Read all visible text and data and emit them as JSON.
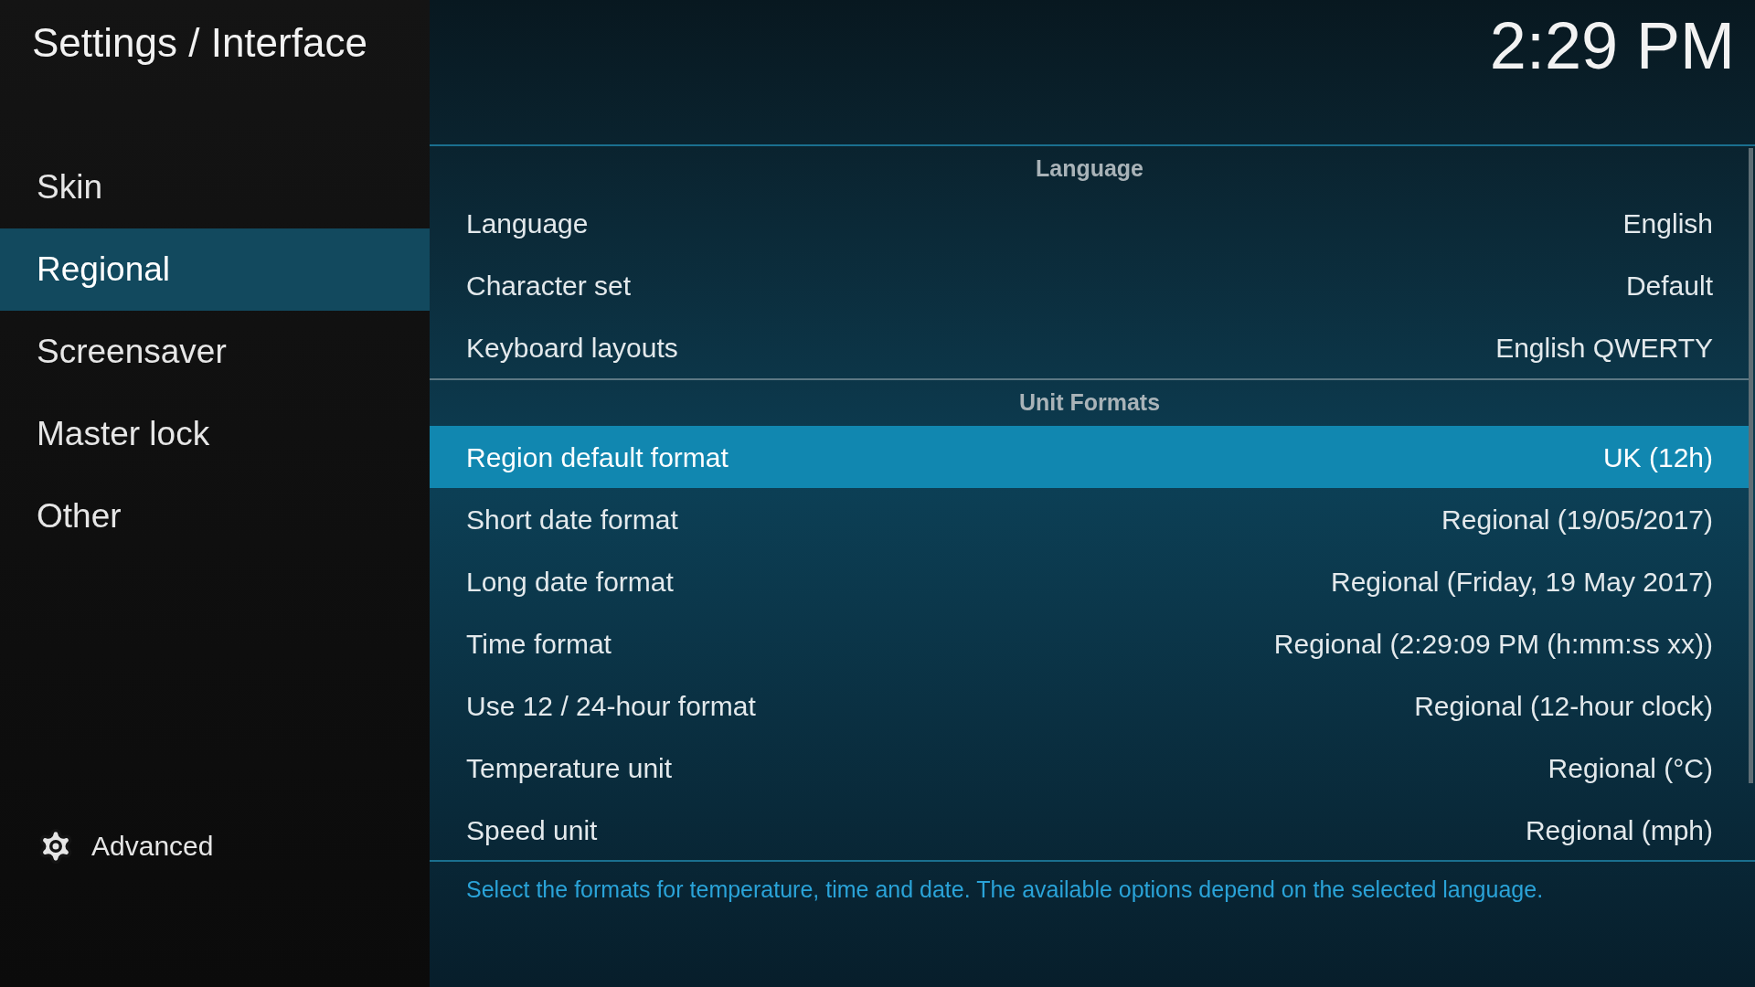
{
  "header": {
    "title": "Settings / Interface",
    "clock": "2:29 PM"
  },
  "sidebar": {
    "items": [
      {
        "label": "Skin",
        "selected": false
      },
      {
        "label": "Regional",
        "selected": true
      },
      {
        "label": "Screensaver",
        "selected": false
      },
      {
        "label": "Master lock",
        "selected": false
      },
      {
        "label": "Other",
        "selected": false
      }
    ],
    "level_button": {
      "label": "Advanced"
    }
  },
  "sections": [
    {
      "title": "Language",
      "rows": [
        {
          "label": "Language",
          "value": "English",
          "selected": false
        },
        {
          "label": "Character set",
          "value": "Default",
          "selected": false
        },
        {
          "label": "Keyboard layouts",
          "value": "English QWERTY",
          "selected": false
        }
      ]
    },
    {
      "title": "Unit Formats",
      "rows": [
        {
          "label": "Region default format",
          "value": "UK (12h)",
          "selected": true
        },
        {
          "label": "Short date format",
          "value": "Regional (19/05/2017)",
          "selected": false
        },
        {
          "label": "Long date format",
          "value": "Regional (Friday, 19 May 2017)",
          "selected": false
        },
        {
          "label": "Time format",
          "value": "Regional (2:29:09 PM (h:mm:ss xx))",
          "selected": false
        },
        {
          "label": "Use 12 / 24-hour format",
          "value": "Regional (12-hour clock)",
          "selected": false
        },
        {
          "label": "Temperature unit",
          "value": "Regional (°C)",
          "selected": false
        },
        {
          "label": "Speed unit",
          "value": "Regional (mph)",
          "selected": false
        }
      ]
    }
  ],
  "description": "Select the formats for temperature, time and date. The available options depend on the selected language."
}
